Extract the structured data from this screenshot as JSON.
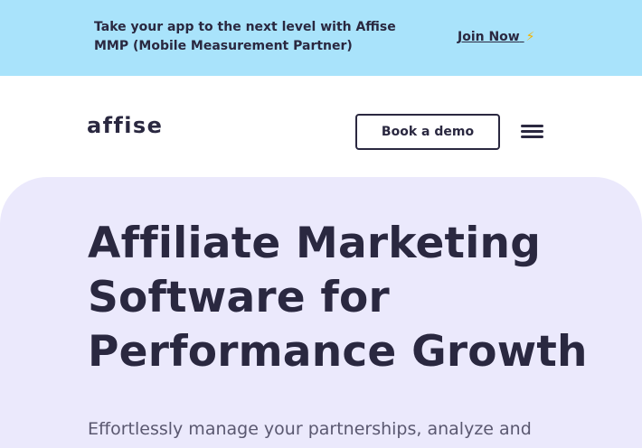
{
  "banner": {
    "text": "Take your app to the next level with Affise MMP (Mobile Measurement Partner)",
    "link_label": "Join Now",
    "link_icon": "lightning-icon",
    "background": "#a9e3fb"
  },
  "header": {
    "logo_text": "affise",
    "demo_button_label": "Book a demo",
    "menu_icon": "hamburger-icon"
  },
  "hero": {
    "title": "Affiliate Marketing Software for Performance Growth",
    "subtitle": "Effortlessly manage your partnerships, analyze and",
    "background": "#ebe9fc"
  },
  "colors": {
    "text_dark": "#2a2840",
    "accent_bolt": "#f4b400"
  }
}
